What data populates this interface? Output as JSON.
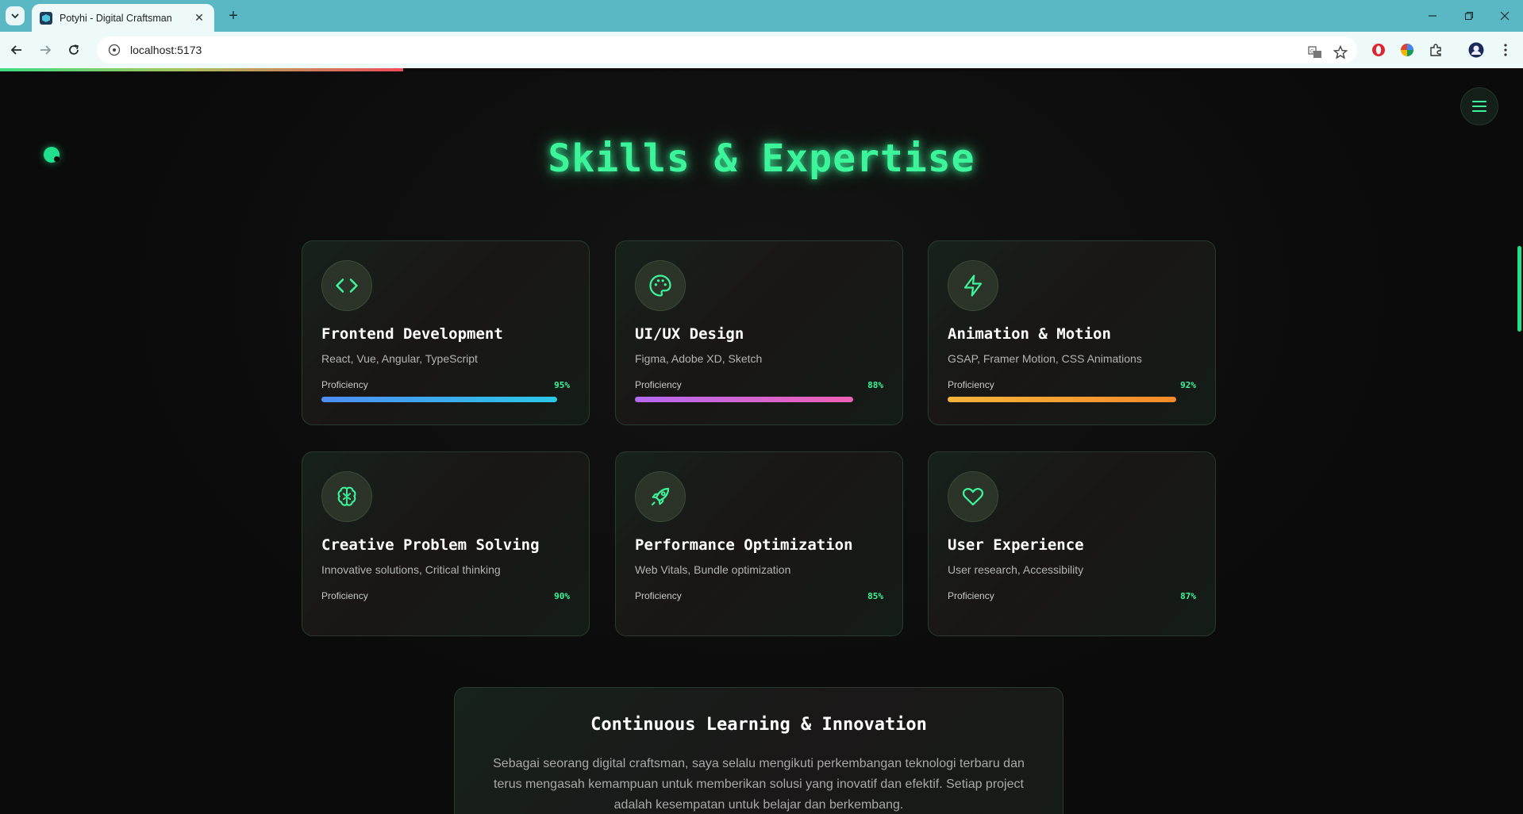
{
  "browser": {
    "tab_title": "Potyhi - Digital Craftsman",
    "url": "localhost:5173"
  },
  "page": {
    "section_title": "Skills & Expertise",
    "accent_color": "#3cf59a",
    "skills": [
      {
        "name": "Frontend Development",
        "tools": "React, Vue, Angular, TypeScript",
        "label": "Proficiency",
        "value": "95%",
        "level": 95,
        "icon": "code-icon",
        "gradient": [
          "#4e8df5",
          "#2ac8e8"
        ]
      },
      {
        "name": "UI/UX Design",
        "tools": "Figma, Adobe XD, Sketch",
        "label": "Proficiency",
        "value": "88%",
        "level": 88,
        "icon": "palette-icon",
        "gradient": [
          "#b46af2",
          "#f05fb3"
        ]
      },
      {
        "name": "Animation & Motion",
        "tools": "GSAP, Framer Motion, CSS Animations",
        "label": "Proficiency",
        "value": "92%",
        "level": 92,
        "icon": "lightning-icon",
        "gradient": [
          "#f5b43a",
          "#f58a2a"
        ]
      },
      {
        "name": "Creative Problem Solving",
        "tools": "Innovative solutions, Critical thinking",
        "label": "Proficiency",
        "value": "90%",
        "level": 90,
        "icon": "brain-icon",
        "gradient": null
      },
      {
        "name": "Performance Optimization",
        "tools": "Web Vitals, Bundle optimization",
        "label": "Proficiency",
        "value": "85%",
        "level": 85,
        "icon": "rocket-icon",
        "gradient": null
      },
      {
        "name": "User Experience",
        "tools": "User research, Accessibility",
        "label": "Proficiency",
        "value": "87%",
        "level": 87,
        "icon": "heart-icon",
        "gradient": null
      }
    ],
    "learning": {
      "title": "Continuous Learning & Innovation",
      "text": "Sebagai seorang digital craftsman, saya selalu mengikuti perkembangan teknologi terbaru dan terus mengasah kemampuan untuk memberikan solusi yang inovatif dan efektif. Setiap project adalah kesempatan untuk belajar dan berkembang."
    }
  }
}
